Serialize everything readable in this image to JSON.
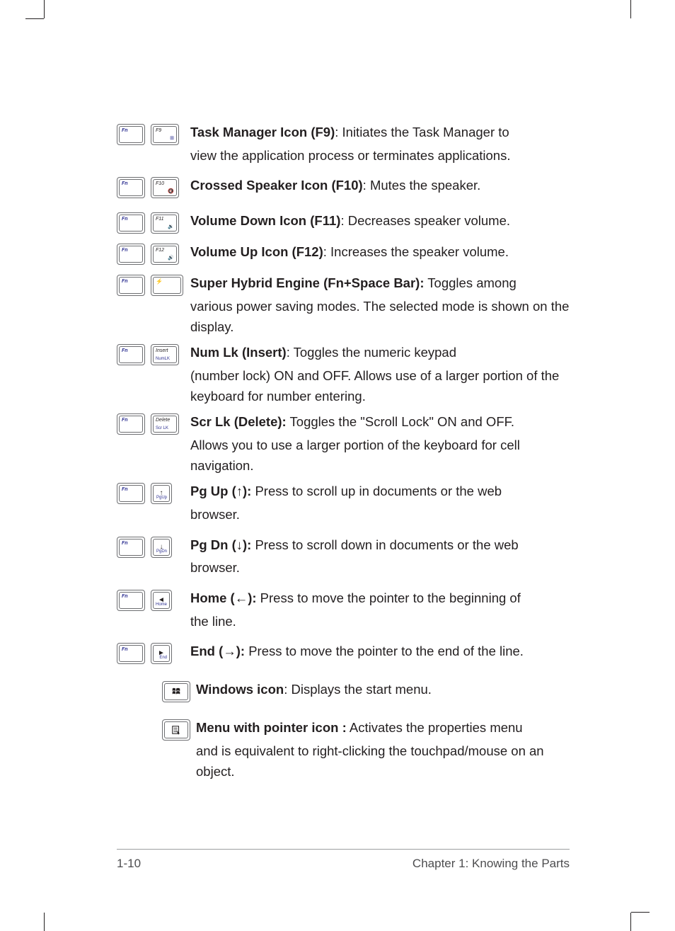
{
  "rows": [
    {
      "id": "f9",
      "keys": [
        "Fn",
        "F9"
      ],
      "key2_sub": "⊞",
      "title": "Task Manager Icon (F9)",
      "after_title": ": Initiates the Task Manager to",
      "cont": "view the application process or terminates applications."
    },
    {
      "id": "f10",
      "keys": [
        "Fn",
        "F10"
      ],
      "key2_sub": "🔇",
      "title": "Crossed Speaker Icon (F10)",
      "after_title": ": Mutes the speaker.",
      "cont": ""
    },
    {
      "id": "f11",
      "keys": [
        "Fn",
        "F11"
      ],
      "key2_sub": "🔉",
      "title": "Volume Down Icon (F11)",
      "after_title": ": Decreases speaker volume.",
      "cont": ""
    },
    {
      "id": "f12",
      "keys": [
        "Fn",
        "F12"
      ],
      "key2_sub": "🔊",
      "title": "Volume Up Icon (F12)",
      "after_title": ": Increases the speaker volume.",
      "cont": ""
    },
    {
      "id": "space",
      "keys": [
        "Fn",
        "␣"
      ],
      "key2_sub": "",
      "title": "Super Hybrid Engine (Fn+Space Bar):",
      "after_title": " Toggles among",
      "cont": "various power saving modes. The selected mode is shown on the display."
    },
    {
      "id": "insert",
      "keys": [
        "Fn",
        "Insert"
      ],
      "key2_sub": "NumLK",
      "title": "Num Lk (Insert)",
      "after_title": ": Toggles the numeric keypad",
      "cont": "(number lock) ON and OFF. Allows use of a larger portion of the keyboard for number entering."
    },
    {
      "id": "delete",
      "keys": [
        "Fn",
        "Delete"
      ],
      "key2_sub": "Scr LK",
      "title": "Scr Lk (Delete):",
      "after_title": " Toggles the \"Scroll Lock\" ON and OFF.",
      "cont": "Allows you to use a larger portion of the keyboard for cell navigation."
    },
    {
      "id": "pgup",
      "keys": [
        "Fn",
        "↑"
      ],
      "key2_sub": "PgUp",
      "narrow": true,
      "title": "Pg Up (↑):",
      "after_title": " Press to scroll up in documents or the web",
      "cont": "browser."
    },
    {
      "id": "pgdn",
      "keys": [
        "Fn",
        "↓"
      ],
      "key2_sub": "PgDn",
      "narrow": true,
      "title": "Pg Dn (↓):",
      "after_title": " Press to scroll down in documents or the web",
      "cont": "browser."
    },
    {
      "id": "home",
      "keys": [
        "Fn",
        "◄"
      ],
      "key2_sub": "Home",
      "narrow": true,
      "title": "Home (←):",
      "after_title": " Press to move the pointer to the beginning of",
      "cont": "the line."
    },
    {
      "id": "end",
      "keys": [
        "Fn",
        "►"
      ],
      "key2_sub": "End",
      "narrow": true,
      "title": "End (→):",
      "after_title": " Press to move the pointer to the end of the line.",
      "cont": ""
    },
    {
      "id": "win",
      "single_key": "win",
      "title": "Windows icon",
      "after_title": ": Displays the start menu.",
      "cont": ""
    },
    {
      "id": "menu",
      "single_key": "menu",
      "title": "Menu with pointer icon :",
      "after_title": " Activates the properties menu",
      "cont": "and is equivalent to right-clicking the touchpad/mouse on an object."
    }
  ],
  "footer": {
    "page": "1-10",
    "chapter": "Chapter 1: Knowing the Parts"
  },
  "fn_label": "Fn"
}
